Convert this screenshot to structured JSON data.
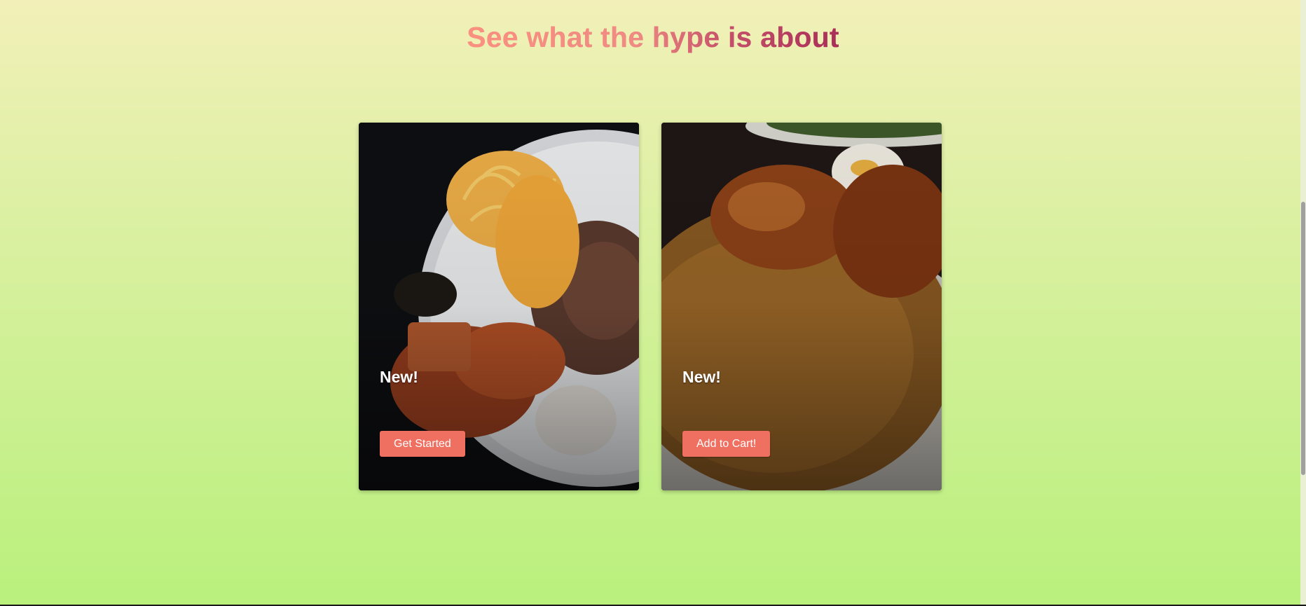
{
  "headline": "See what the hype is about",
  "colors": {
    "accent_button": "#ef6f61",
    "headline_start": "#fa9080",
    "headline_end": "#aa2e58",
    "background_top": "#f2f0b8",
    "background_bottom": "#b9f07c"
  },
  "cards": [
    {
      "badge": "New!",
      "button_label": "Get Started",
      "image": "plate-spaghetti-gari-beans-stew-egg"
    },
    {
      "badge": "New!",
      "button_label": "Add to Cart!",
      "image": "plate-jollof-rice-chicken-egg"
    }
  ]
}
